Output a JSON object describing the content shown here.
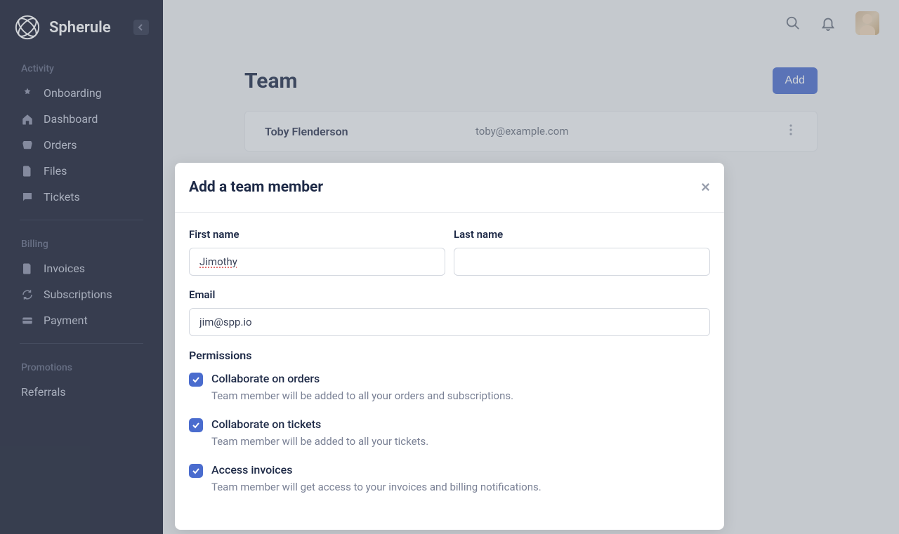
{
  "app": {
    "name": "Spherule"
  },
  "sidebar": {
    "sections": {
      "activity": {
        "label": "Activity"
      },
      "billing": {
        "label": "Billing"
      },
      "promotions": {
        "label": "Promotions"
      }
    },
    "items": {
      "onboarding": "Onboarding",
      "dashboard": "Dashboard",
      "orders": "Orders",
      "files": "Files",
      "tickets": "Tickets",
      "invoices": "Invoices",
      "subscriptions": "Subscriptions",
      "payment": "Payment",
      "referrals": "Referrals"
    }
  },
  "page": {
    "title": "Team",
    "add_button": "Add"
  },
  "team": {
    "name": "Toby Flenderson",
    "email": "toby@example.com"
  },
  "modal": {
    "title": "Add a team member",
    "labels": {
      "first_name": "First name",
      "last_name": "Last name",
      "email": "Email",
      "permissions": "Permissions"
    },
    "values": {
      "first_name": "Jimothy",
      "last_name": "",
      "email": "jim@spp.io"
    },
    "permissions": [
      {
        "label": "Collaborate on orders",
        "desc": "Team member will be added to all your orders and subscriptions.",
        "checked": true
      },
      {
        "label": "Collaborate on tickets",
        "desc": "Team member will be added to all your tickets.",
        "checked": true
      },
      {
        "label": "Access invoices",
        "desc": "Team member will get access to your invoices and billing notifications.",
        "checked": true
      }
    ]
  }
}
